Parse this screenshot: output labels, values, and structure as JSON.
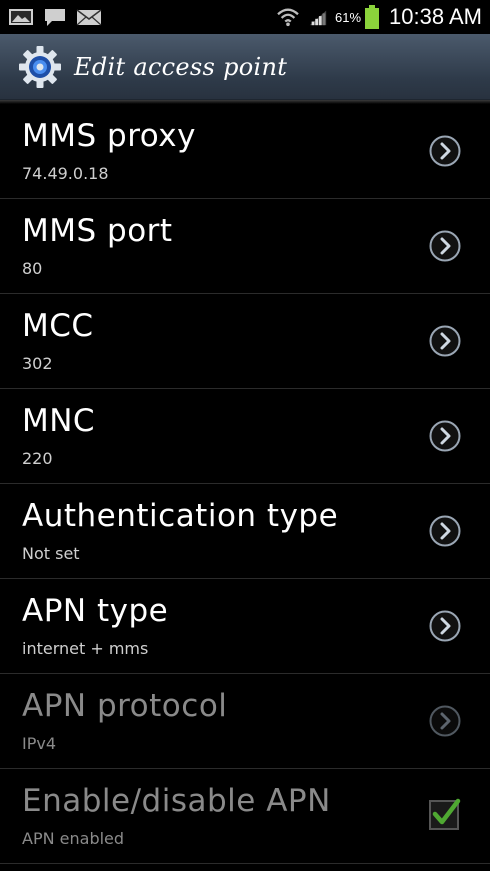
{
  "status_bar": {
    "icons_left": [
      "gallery-icon",
      "message-icon",
      "email-icon"
    ],
    "icons_right": [
      "wifi-icon",
      "signal-icon",
      "battery-icon"
    ],
    "battery_percent": "61%",
    "time": "10:38 AM"
  },
  "action_bar": {
    "title": "Edit access point",
    "icon": "settings-gear-icon"
  },
  "items": [
    {
      "title": "MMS proxy",
      "value": "74.49.0.18",
      "enabled": true,
      "control": "chevron"
    },
    {
      "title": "MMS port",
      "value": "80",
      "enabled": true,
      "control": "chevron"
    },
    {
      "title": "MCC",
      "value": "302",
      "enabled": true,
      "control": "chevron"
    },
    {
      "title": "MNC",
      "value": "220",
      "enabled": true,
      "control": "chevron"
    },
    {
      "title": "Authentication type",
      "value": "Not set",
      "enabled": true,
      "control": "chevron"
    },
    {
      "title": "APN type",
      "value": "internet + mms",
      "enabled": true,
      "control": "chevron"
    },
    {
      "title": "APN protocol",
      "value": "IPv4",
      "enabled": false,
      "control": "chevron"
    },
    {
      "title": "Enable/disable APN",
      "value": "APN enabled",
      "enabled": false,
      "control": "checkbox",
      "checked": true
    }
  ],
  "colors": {
    "action_bar": "#3b4757",
    "check": "#5cc33a",
    "battery": "#8bd33b"
  }
}
